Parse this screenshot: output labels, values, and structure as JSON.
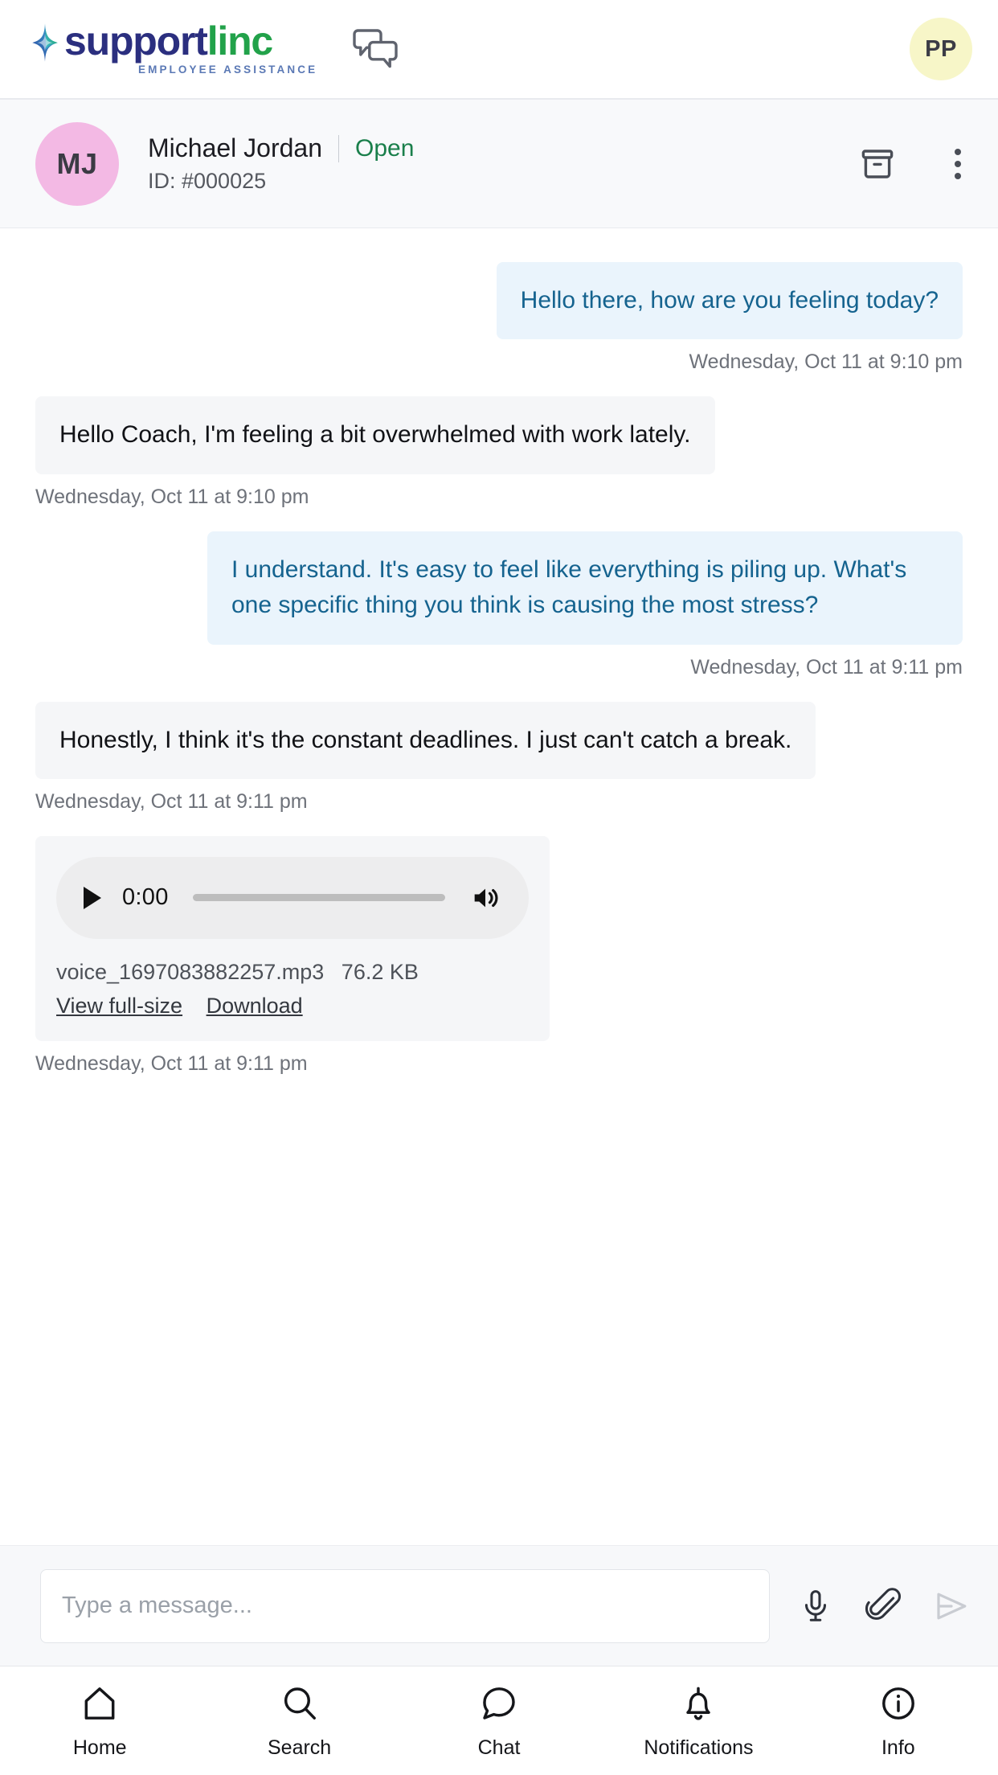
{
  "brand": {
    "name_part1": "support",
    "name_part2": "linc",
    "tagline": "EMPLOYEE ASSISTANCE",
    "star_icon": "sparkle-star-icon",
    "header_chat_icon": "double-speech-bubble-icon",
    "user_avatar_initials": "PP",
    "user_avatar_bg": "#f7f6c8"
  },
  "conversation": {
    "avatar_initials": "MJ",
    "avatar_bg": "#f3b9e4",
    "name": "Michael Jordan",
    "status": "Open",
    "status_color": "#1a7f4b",
    "id_label": "ID: #000025",
    "archive_icon": "archive-box-icon",
    "menu_icon": "more-vertical-icon"
  },
  "messages": [
    {
      "direction": "out",
      "text": "Hello there, how are you feeling today?",
      "timestamp": "Wednesday, Oct 11 at 9:10 pm"
    },
    {
      "direction": "in",
      "text": "Hello Coach, I'm feeling a bit overwhelmed with work lately.",
      "timestamp": "Wednesday, Oct 11 at 9:10 pm"
    },
    {
      "direction": "out",
      "text": "I understand. It's easy to feel like everything is piling up. What's one specific thing you think is causing the most stress?",
      "timestamp": "Wednesday, Oct 11 at 9:11 pm"
    },
    {
      "direction": "in",
      "text": "Honestly, I think it's the constant deadlines. I just can't catch a break.",
      "timestamp": "Wednesday, Oct 11 at 9:11 pm"
    }
  ],
  "attachment": {
    "play_icon": "play-icon",
    "current_time": "0:00",
    "volume_icon": "volume-icon",
    "progress_percent": 0,
    "file_name": "voice_1697083882257.mp3",
    "file_size": "76.2 KB",
    "view_link": "View full-size",
    "download_link": "Download",
    "timestamp": "Wednesday, Oct 11 at 9:11 pm"
  },
  "composer": {
    "placeholder": "Type a message...",
    "value": "",
    "mic_icon": "microphone-icon",
    "attach_icon": "paperclip-icon",
    "send_icon": "send-icon",
    "send_enabled": false
  },
  "bottom_nav": {
    "items": [
      {
        "label": "Home",
        "icon": "home-icon"
      },
      {
        "label": "Search",
        "icon": "search-icon"
      },
      {
        "label": "Chat",
        "icon": "chat-bubble-icon"
      },
      {
        "label": "Notifications",
        "icon": "bell-icon"
      },
      {
        "label": "Info",
        "icon": "info-circle-icon"
      }
    ]
  }
}
